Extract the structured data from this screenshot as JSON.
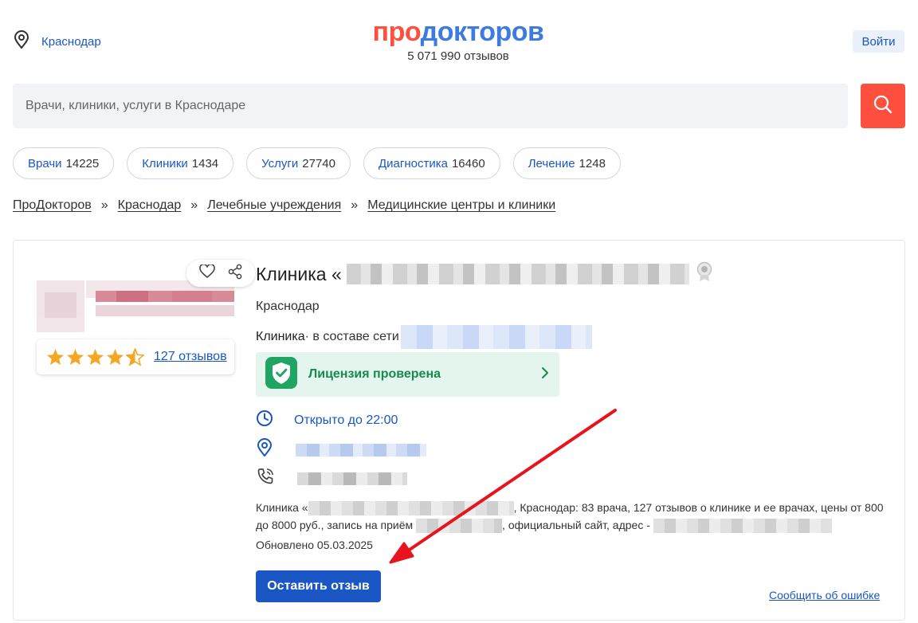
{
  "header": {
    "city": "Краснодар",
    "logo_part1": "про",
    "logo_part2": "докторов",
    "reviews_total": "5 071 990 отзывов",
    "login_label": "Войти"
  },
  "search": {
    "placeholder": "Врачи, клиники, услуги в Краснодаре"
  },
  "categories": [
    {
      "label": "Врачи",
      "count": "14225"
    },
    {
      "label": "Клиники",
      "count": "1434"
    },
    {
      "label": "Услуги",
      "count": "27740"
    },
    {
      "label": "Диагностика",
      "count": "16460"
    },
    {
      "label": "Лечение",
      "count": "1248"
    }
  ],
  "breadcrumb": {
    "items": [
      "ПроДокторов",
      "Краснодар",
      "Лечебные учреждения",
      "Медицинские центры и клиники"
    ],
    "separator": "»"
  },
  "clinic": {
    "title_prefix": "Клиника «",
    "city": "Краснодар",
    "type": "Клиника",
    "network_prefix": " · в составе сети",
    "rating_value": 4.5,
    "reviews_link": "127 отзывов",
    "license_label": "Лицензия проверена",
    "hours": "Открыто до 22:00",
    "description_part1": "Клиника «",
    "description_part2": ", Краснодар: 83 врача, 127 отзывов о клинике и ее врачах, цены от 800 до 8000 руб., запись на приём",
    "description_part3": ", официальный сайт, адрес - ",
    "updated": "Обновлено 05.03.2025",
    "leave_review_label": "Оставить отзыв",
    "report_error_label": "Сообщить об ошибке"
  },
  "colors": {
    "accent_blue": "#1a56c4",
    "brand_red": "#ff4f3f",
    "license_green": "#168a4f",
    "star_orange": "#f5a623",
    "annotation_arrow": "#e8141c"
  },
  "icons": {
    "city": "location-pin-icon",
    "search": "search-icon",
    "favorite": "heart-icon",
    "share": "share-icon",
    "award": "award-icon",
    "license": "shield-check-icon",
    "license_more": "chevron-right-icon",
    "hours": "clock-icon",
    "address": "location-pin-icon",
    "phone": "phone-icon"
  }
}
